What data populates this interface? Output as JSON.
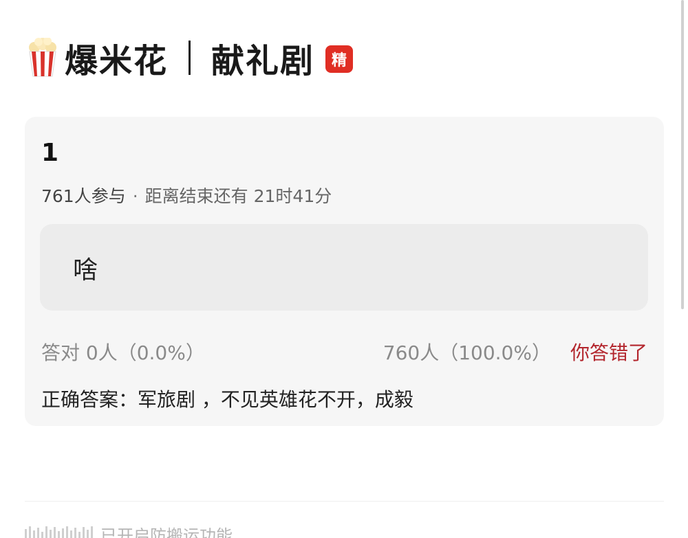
{
  "header": {
    "icon": "popcorn-icon",
    "title_left": "爆米花",
    "title_right": "献礼剧",
    "badge": "精",
    "badge_color": "#e02e24"
  },
  "quiz": {
    "number": "1",
    "participants": "761人参与",
    "separator": "·",
    "remaining": "距离结束还有 21时41分",
    "option": "啥",
    "correct_stats": "答对  0人（0.0%）",
    "wrong_stats": "760人（100.0%）",
    "result": "你答错了",
    "result_color": "#b3262d",
    "answer": "正确答案：军旅剧 ，不见英雄花不开，成毅"
  },
  "footer": {
    "icon": "anti-repost-icon",
    "text": "已开启防搬运功能"
  }
}
